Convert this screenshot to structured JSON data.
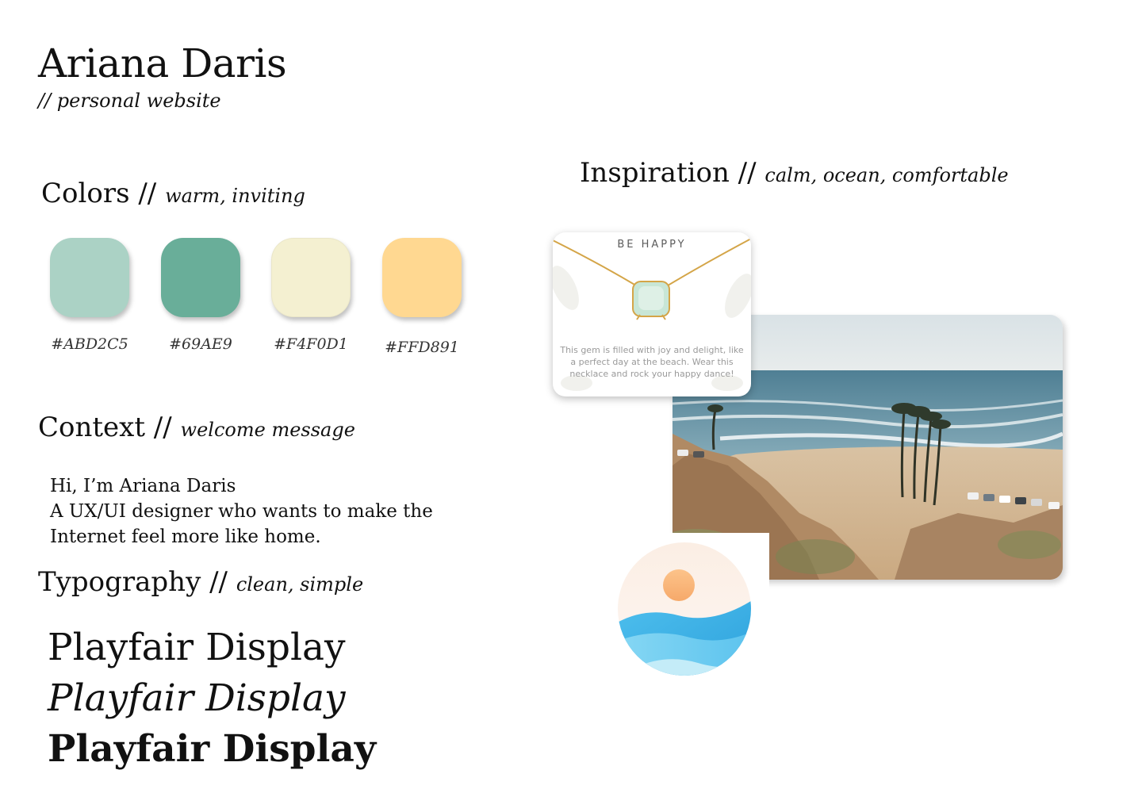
{
  "header": {
    "title": "Ariana Daris",
    "subtitle": "// personal website"
  },
  "colors_section": {
    "heading": "Colors //",
    "descriptor": "warm, inviting",
    "swatches": [
      {
        "color": "#ABD2C5",
        "label": "#ABD2C5"
      },
      {
        "color": "#69AE99",
        "label": "#69AE9"
      },
      {
        "color": "#F4F0D1",
        "label": "#F4F0D1"
      },
      {
        "color": "#FFD891",
        "label": "#FFD891"
      }
    ]
  },
  "context_section": {
    "heading": "Context //",
    "descriptor": "welcome message",
    "lines": [
      "Hi, I’m Ariana Daris",
      "A UX/UI designer who wants to make the",
      "Internet feel more like home."
    ]
  },
  "typography_section": {
    "heading": "Typography //",
    "descriptor": "clean, simple",
    "samples": {
      "regular": "Playfair Display",
      "italic": "Playfair Display",
      "bold": "Playfair Display"
    }
  },
  "inspiration_section": {
    "heading": "Inspiration //",
    "descriptor": "calm, ocean, comfortable",
    "necklace_card": {
      "title": "BE HAPPY",
      "text": "This gem is filled with joy and delight, like a perfect day at the beach. Wear this necklace and rock your happy dance!",
      "icon": "necklace-icon"
    },
    "beach_photo": {
      "icon": "beach-photo"
    },
    "logo": {
      "icon": "sun-wave-logo-icon"
    }
  }
}
